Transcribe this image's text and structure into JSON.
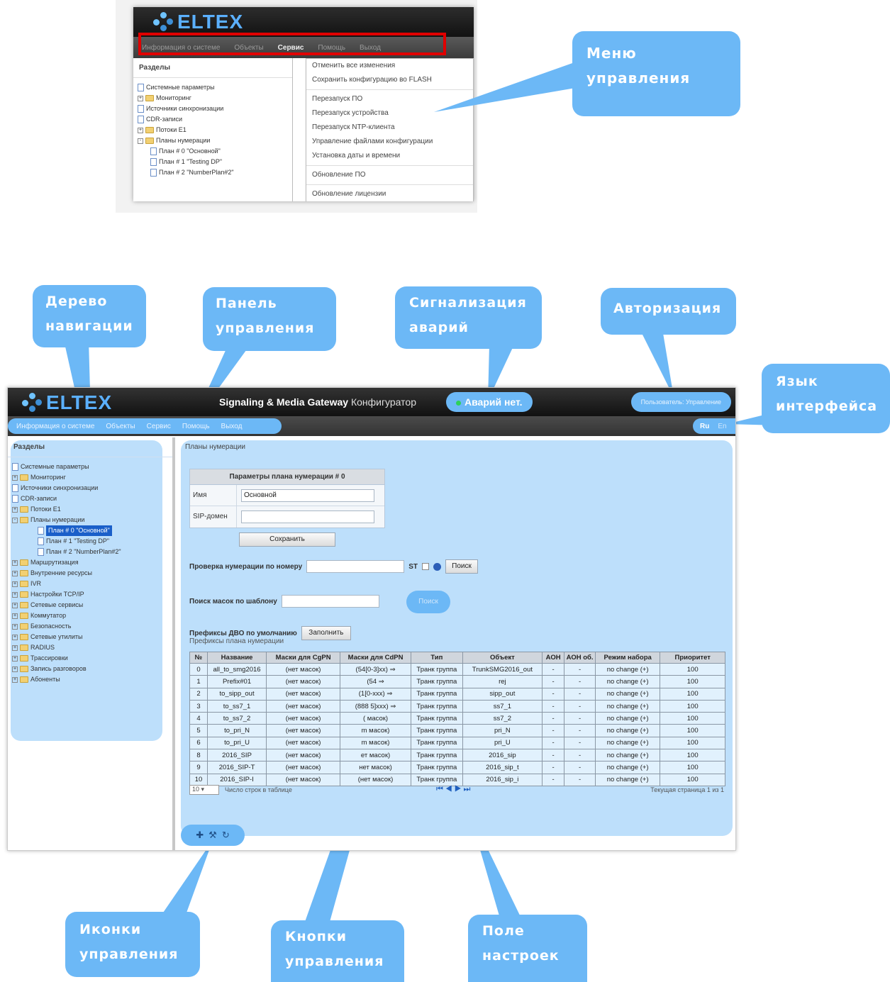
{
  "brand": {
    "logo_text": "ELTEX"
  },
  "menu_callout": {
    "menu_items": [
      "Информация о системе",
      "Объекты",
      "Сервис",
      "Помощь",
      "Выход"
    ],
    "active_item": "Сервис",
    "sections_header": "Разделы",
    "tree": [
      {
        "label": "Системные параметры",
        "kind": "doc",
        "indent": 0
      },
      {
        "label": "Мониторинг",
        "kind": "folder",
        "toggle": "+",
        "indent": 0
      },
      {
        "label": "Источники синхронизации",
        "kind": "doc",
        "indent": 0
      },
      {
        "label": "CDR-записи",
        "kind": "doc",
        "indent": 0
      },
      {
        "label": "Потоки E1",
        "kind": "folder",
        "toggle": "+",
        "indent": 0
      },
      {
        "label": "Планы нумерации",
        "kind": "folder",
        "toggle": "-",
        "indent": 0
      },
      {
        "label": "План # 0 \"Основной\"",
        "kind": "doc",
        "indent": 1
      },
      {
        "label": "План # 1 \"Testing DP\"",
        "kind": "doc",
        "indent": 1
      },
      {
        "label": "План # 2 \"NumberPlan#2\"",
        "kind": "doc",
        "indent": 1
      }
    ],
    "dropdown": [
      {
        "label": "Отменить все изменения"
      },
      {
        "label": "Сохранить конфигурацию во FLASH"
      },
      {
        "sep": true
      },
      {
        "label": "Перезапуск ПО"
      },
      {
        "label": "Перезапуск устройства"
      },
      {
        "label": "Перезапуск NTP-клиента"
      },
      {
        "label": "Управление файлами конфигурации"
      },
      {
        "label": "Установка даты и времени"
      },
      {
        "sep": true
      },
      {
        "label": "Обновление ПО"
      },
      {
        "sep": true
      },
      {
        "label": "Обновление лицензии"
      }
    ]
  },
  "callouts": {
    "menu": [
      "Меню",
      "управления"
    ],
    "nav_tree": [
      "Дерево",
      "навигации"
    ],
    "control_panel": [
      "Панель",
      "управления"
    ],
    "alarms": [
      "Сигнализация",
      "аварий"
    ],
    "auth": [
      "Авторизация"
    ],
    "language": [
      "Язык",
      "интерфейса"
    ],
    "icons": [
      "Иконки",
      "управления"
    ],
    "buttons": [
      "Кнопки",
      "управления"
    ],
    "settings": [
      "Поле",
      "настроек"
    ]
  },
  "main": {
    "product": "Signaling & Media Gateway",
    "configurator": "Конфигуратор",
    "alarm_text": "Аварий нет.",
    "user_text": "Пользователь: Управление",
    "menu_items": [
      "Информация о системе",
      "Объекты",
      "Сервис",
      "Помощь",
      "Выход"
    ],
    "lang": {
      "ru": "Ru",
      "en": "En"
    },
    "sections_header": "Разделы",
    "tree": [
      {
        "label": "Системные параметры",
        "kind": "doc",
        "indent": 0
      },
      {
        "label": "Мониторинг",
        "kind": "folder",
        "toggle": "+",
        "indent": 0
      },
      {
        "label": "Источники синхронизации",
        "kind": "doc",
        "indent": 0
      },
      {
        "label": "CDR-записи",
        "kind": "doc",
        "indent": 0
      },
      {
        "label": "Потоки E1",
        "kind": "folder",
        "toggle": "+",
        "indent": 0
      },
      {
        "label": "Планы нумерации",
        "kind": "folder",
        "toggle": "-",
        "indent": 0
      },
      {
        "label": "План # 0 \"Основной\"",
        "kind": "doc",
        "indent": 2,
        "selected": true
      },
      {
        "label": "План # 1 \"Testing DP\"",
        "kind": "doc",
        "indent": 2
      },
      {
        "label": "План # 2 \"NumberPlan#2\"",
        "kind": "doc",
        "indent": 2
      },
      {
        "label": "Маршрутизация",
        "kind": "folder",
        "toggle": "+",
        "indent": 0
      },
      {
        "label": "Внутренние ресурсы",
        "kind": "folder",
        "toggle": "+",
        "indent": 0
      },
      {
        "label": "IVR",
        "kind": "folder",
        "toggle": "+",
        "indent": 0
      },
      {
        "label": "Настройки TCP/IP",
        "kind": "folder",
        "toggle": "+",
        "indent": 0
      },
      {
        "label": "Сетевые сервисы",
        "kind": "folder",
        "toggle": "+",
        "indent": 0
      },
      {
        "label": "Коммутатор",
        "kind": "folder",
        "toggle": "+",
        "indent": 0
      },
      {
        "label": "Безопасность",
        "kind": "folder",
        "toggle": "+",
        "indent": 0
      },
      {
        "label": "Сетевые утилиты",
        "kind": "folder",
        "toggle": "+",
        "indent": 0
      },
      {
        "label": "RADIUS",
        "kind": "folder",
        "toggle": "+",
        "indent": 0
      },
      {
        "label": "Трассировки",
        "kind": "folder",
        "toggle": "+",
        "indent": 0
      },
      {
        "label": "Запись разговоров",
        "kind": "folder",
        "toggle": "+",
        "indent": 0
      },
      {
        "label": "Абоненты",
        "kind": "folder",
        "toggle": "+",
        "indent": 0
      }
    ],
    "breadcrumb": "Планы нумерации",
    "params": {
      "title": "Параметры плана нумерации # 0",
      "name_label": "Имя",
      "name_value": "Основной",
      "sip_label": "SIP-домен",
      "sip_value": "",
      "save_button": "Сохранить"
    },
    "check_number": {
      "label": "Проверка нумерации по номеру",
      "st_label": "ST",
      "button": "Поиск"
    },
    "mask_search": {
      "label": "Поиск масок по шаблону",
      "button": "Поиск"
    },
    "prefixes_default": {
      "label": "Префиксы ДВО по умолчанию",
      "button": "Заполнить"
    },
    "table_caption": "Префиксы плана нумерации",
    "table": {
      "headers": [
        "№",
        "Название",
        "Маски для CgPN",
        "Маски для CdPN",
        "Тип",
        "Объект",
        "АОН",
        "АОН об.",
        "Режим набора",
        "Приоритет"
      ],
      "rows": [
        [
          "0",
          "all_to_smg2016",
          "(нет масок)",
          "(54[0-3]xx) ⇒",
          "Транк группа",
          "TrunkSMG2016_out",
          "-",
          "-",
          "no change (+)",
          "100"
        ],
        [
          "1",
          "Prefix#01",
          "(нет масок)",
          "(54 ⇒",
          "Транк группа",
          "rej",
          "-",
          "-",
          "no change (+)",
          "100"
        ],
        [
          "2",
          "to_sipp_out",
          "(нет масок)",
          "(1[0-xxx) ⇒",
          "Транк группа",
          "sipp_out",
          "-",
          "-",
          "no change (+)",
          "100"
        ],
        [
          "3",
          "to_ss7_1",
          "(нет масок)",
          "(888 5]xxx) ⇒",
          "Транк группа",
          "ss7_1",
          "-",
          "-",
          "no change (+)",
          "100"
        ],
        [
          "4",
          "to_ss7_2",
          "(нет масок)",
          "( масок)",
          "Транк группа",
          "ss7_2",
          "-",
          "-",
          "no change (+)",
          "100"
        ],
        [
          "5",
          "to_pri_N",
          "(нет масок)",
          "m масок)",
          "Транк группа",
          "pri_N",
          "-",
          "-",
          "no change (+)",
          "100"
        ],
        [
          "6",
          "to_pri_U",
          "(нет масок)",
          "m масок)",
          "Транк группа",
          "pri_U",
          "-",
          "-",
          "no change (+)",
          "100"
        ],
        [
          "8",
          "2016_SIP",
          "(нет масок)",
          "ет масок)",
          "Транк группа",
          "2016_sip",
          "-",
          "-",
          "no change (+)",
          "100"
        ],
        [
          "9",
          "2016_SIP-T",
          "(нет масок)",
          "нет масок)",
          "Транк группа",
          "2016_sip_t",
          "-",
          "-",
          "no change (+)",
          "100"
        ],
        [
          "10",
          "2016_SIP-I",
          "(нет масок)",
          "(нет масок)",
          "Транк группа",
          "2016_sip_i",
          "-",
          "-",
          "no change (+)",
          "100"
        ]
      ]
    },
    "pager": {
      "page_size": "10",
      "rows_label": "Число строк в таблице",
      "page_label": "Текущая страница 1 из 1"
    },
    "control_icons": [
      "add-icon",
      "tools-icon",
      "refresh-icon"
    ]
  },
  "colors": {
    "accent": "#6cb8f6",
    "selection": "#1a5fc9",
    "highlight_frame": "#e00000"
  }
}
